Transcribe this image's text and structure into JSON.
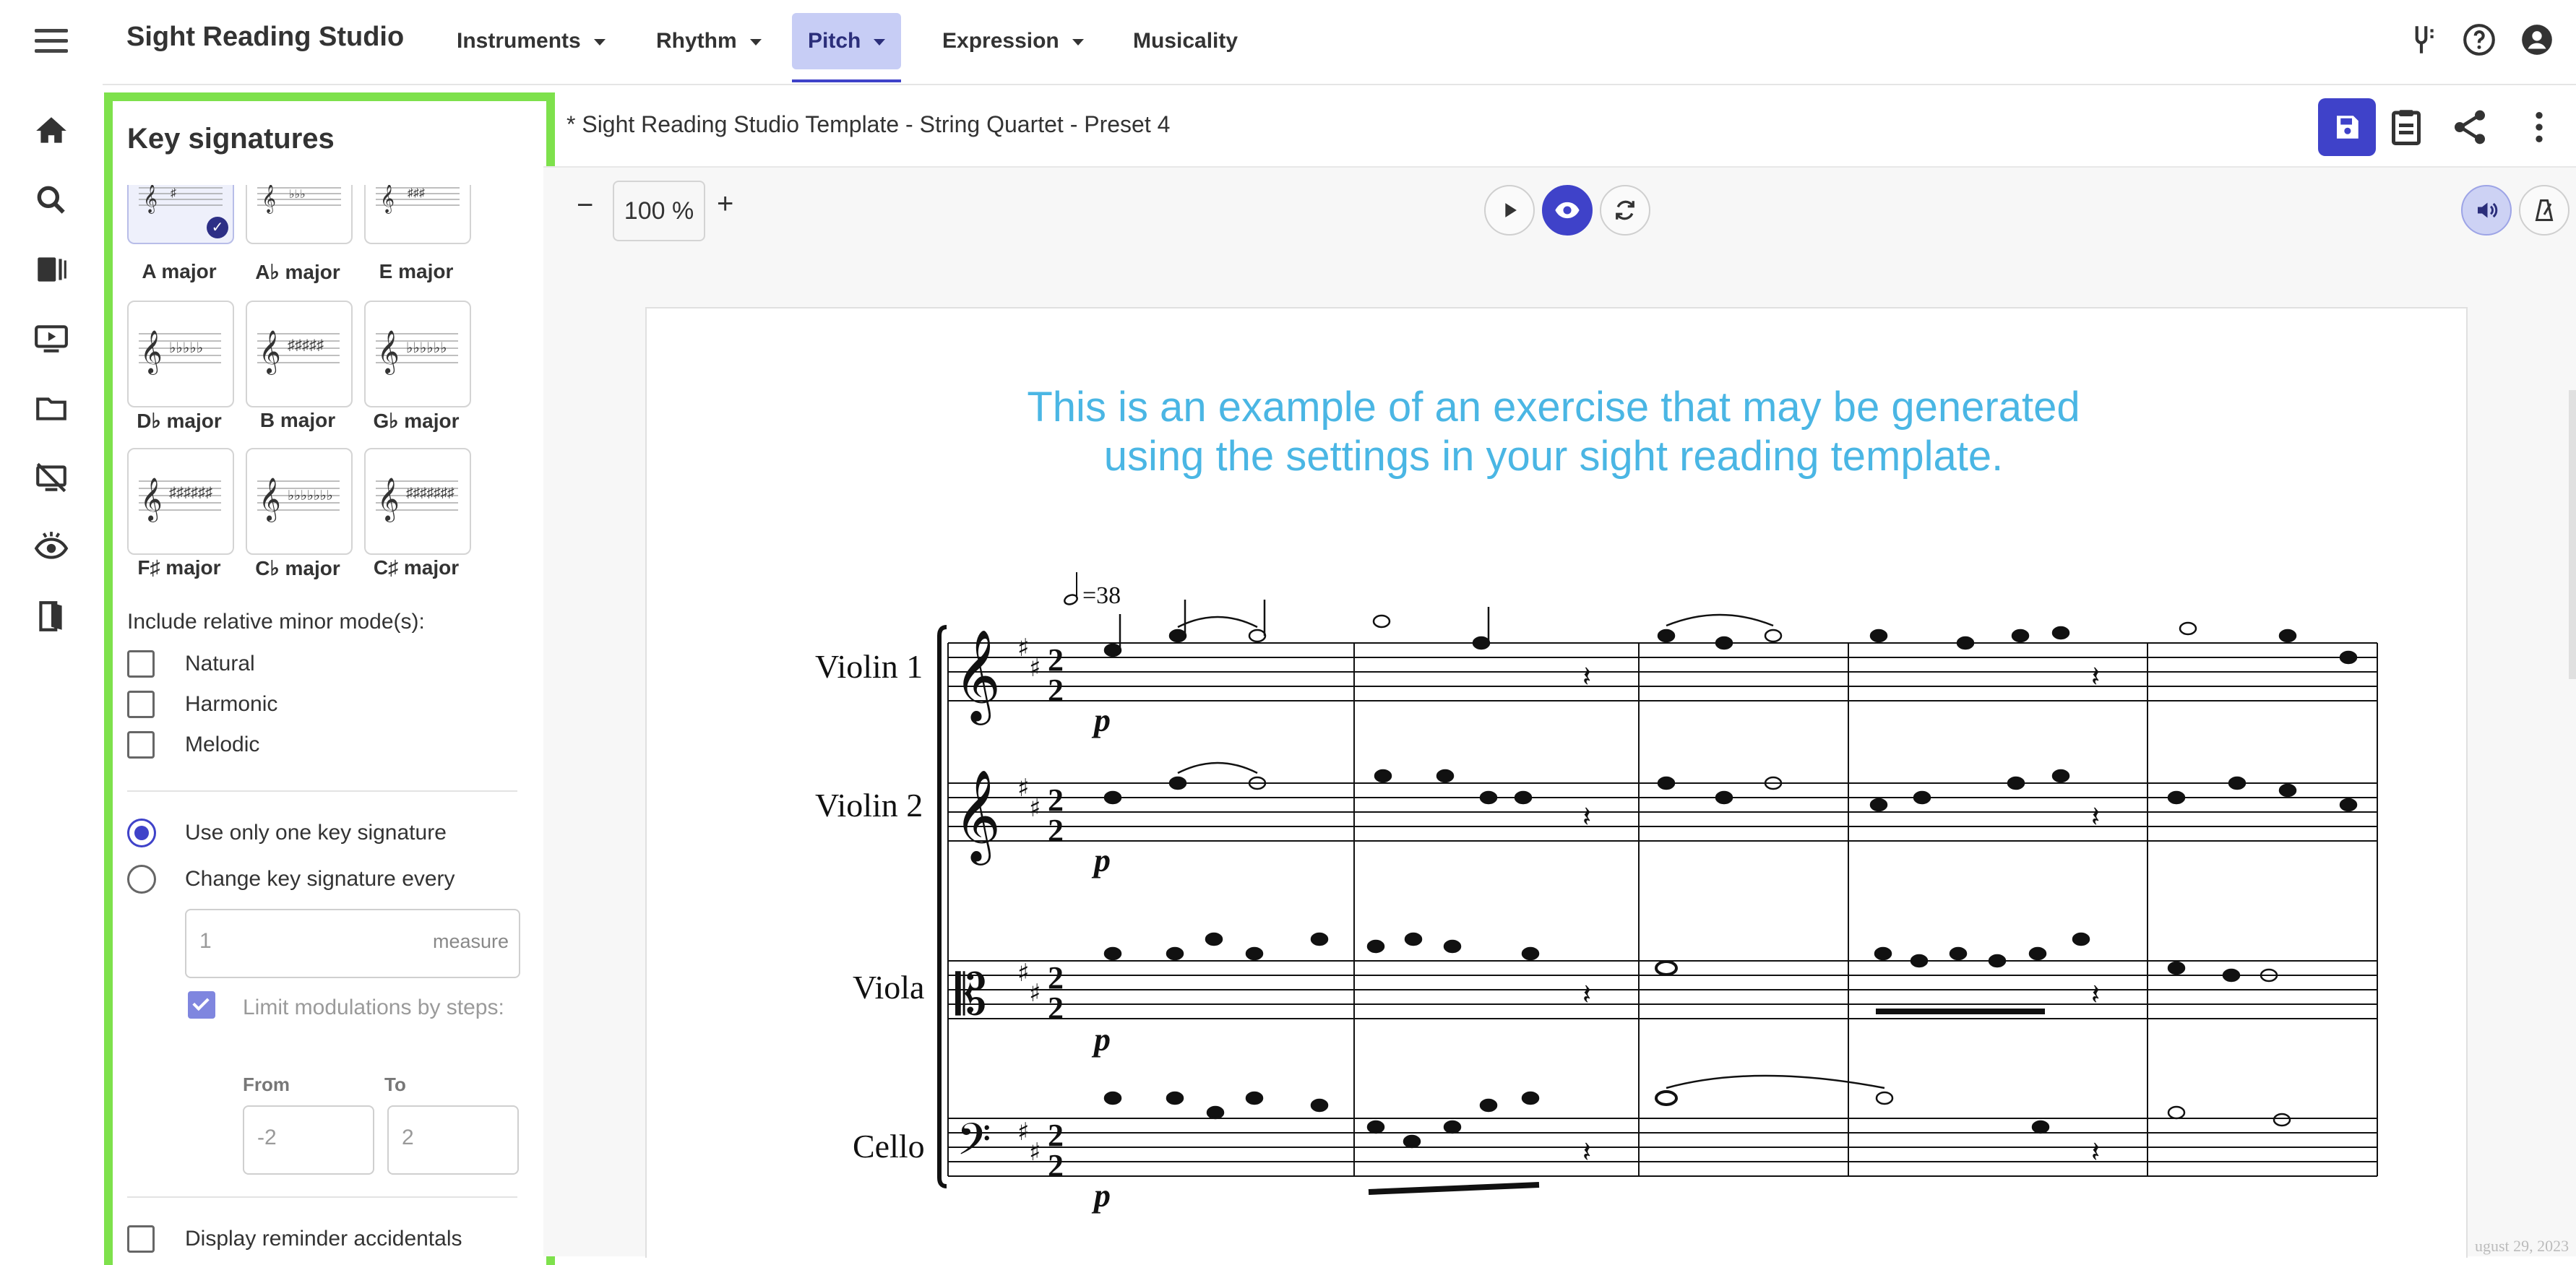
{
  "app": {
    "title": "Sight Reading Studio"
  },
  "menu": [
    {
      "label": "Instruments",
      "has_dropdown": true
    },
    {
      "label": "Rhythm",
      "has_dropdown": true
    },
    {
      "label": "Pitch",
      "has_dropdown": true,
      "active": true
    },
    {
      "label": "Expression",
      "has_dropdown": true
    },
    {
      "label": "Musicality",
      "has_dropdown": false
    }
  ],
  "top_icons": [
    "tuning-fork-icon",
    "help-icon",
    "account-icon"
  ],
  "rail_icons": [
    "home-icon",
    "search-icon",
    "library-icon",
    "play-screen-icon",
    "folder-icon",
    "no-screen-icon",
    "eye-ear-icon",
    "exit-icon"
  ],
  "panel": {
    "title": "Key signatures",
    "keys": [
      {
        "label": "A major",
        "selected": true
      },
      {
        "label": "A♭ major",
        "selected": false
      },
      {
        "label": "E major",
        "selected": false
      },
      {
        "label": "D♭ major",
        "selected": false
      },
      {
        "label": "B major",
        "selected": false
      },
      {
        "label": "G♭ major",
        "selected": false
      },
      {
        "label": "F♯ major",
        "selected": false
      },
      {
        "label": "C♭ major",
        "selected": false
      },
      {
        "label": "C♯ major",
        "selected": false
      }
    ],
    "relative_minor_label": "Include relative minor mode(s):",
    "minor_modes": [
      {
        "label": "Natural",
        "checked": false
      },
      {
        "label": "Harmonic",
        "checked": false
      },
      {
        "label": "Melodic",
        "checked": false
      }
    ],
    "key_mode": [
      {
        "label": "Use only one key signature",
        "checked": true
      },
      {
        "label": "Change key signature every",
        "checked": false
      }
    ],
    "change_every": {
      "value": "1",
      "unit": "measure"
    },
    "limit_modulations": {
      "label": "Limit modulations by steps:",
      "checked": true
    },
    "from": {
      "label": "From",
      "value": "-2"
    },
    "to": {
      "label": "To",
      "value": "2"
    },
    "reminder_accidentals": {
      "label": "Display reminder accidentals",
      "checked": false
    }
  },
  "document": {
    "title": "* Sight Reading Studio Template - String Quartet - Preset 4"
  },
  "header_icons": [
    "save-icon",
    "clipboard-icon",
    "share-icon",
    "more-vert-icon"
  ],
  "zoom": {
    "minus": "−",
    "value": "100",
    "unit": "%",
    "plus": "+"
  },
  "score": {
    "example_line1": "This is an example of an exercise that may be generated",
    "example_line2": "using the settings in your sight reading template.",
    "tempo": "=38",
    "instruments": [
      "Violin 1",
      "Violin 2",
      "Viola",
      "Cello"
    ],
    "dynamic": "p",
    "date_fragment": "ugust 29, 2023"
  },
  "colors": {
    "accent": "#3f42c9",
    "panel_border": "#7ee14c",
    "example_text": "#4ab6e4"
  }
}
